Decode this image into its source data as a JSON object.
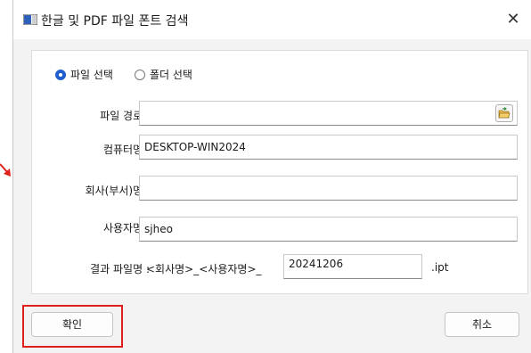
{
  "window": {
    "title": "한글 및 PDF 파일 폰트 검색",
    "close_glyph": "✕"
  },
  "mode": {
    "options": [
      {
        "label": "파일 선택",
        "checked": true
      },
      {
        "label": "폴더 선택",
        "checked": false
      }
    ]
  },
  "form": {
    "file_path_label": "파일 경로 :",
    "file_path_value": "",
    "computer_label": "컴퓨터명 :",
    "computer_value": "DESKTOP-WIN2024",
    "company_label": "회사(부서)명 :",
    "company_value": "",
    "user_label": "사용자명 :",
    "user_value": "sjheo",
    "result_label": "결과 파일명 :",
    "result_prefix": "<회사명>_<사용자명>_",
    "result_value": "20241206",
    "result_ext": ".ipt"
  },
  "buttons": {
    "ok": "확인",
    "cancel": "취소"
  },
  "colors": {
    "accent": "#1f5fcf",
    "highlight": "#e0201b"
  },
  "icons": {
    "app": "app-window-icon",
    "browse": "folder-open-icon",
    "close": "close-icon"
  }
}
